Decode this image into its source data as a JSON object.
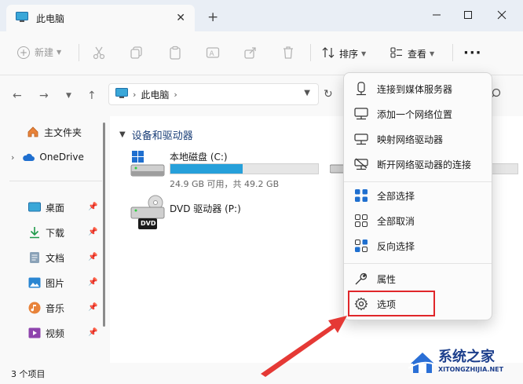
{
  "window": {
    "tab_title": "此电脑",
    "new_tab_glyph": "+",
    "close_tab_glyph": "✕"
  },
  "toolbar": {
    "new_label": "新建",
    "sort_label": "排序",
    "view_label": "查看",
    "more_glyph": "···"
  },
  "address": {
    "path": "此电脑"
  },
  "sidebar": {
    "items": [
      {
        "label": "主文件夹",
        "icon": "home-icon"
      },
      {
        "label": "OneDrive",
        "icon": "cloud-icon"
      },
      {
        "label": "桌面",
        "icon": "desktop-icon"
      },
      {
        "label": "下载",
        "icon": "download-icon"
      },
      {
        "label": "文档",
        "icon": "document-icon"
      },
      {
        "label": "图片",
        "icon": "picture-icon"
      },
      {
        "label": "音乐",
        "icon": "music-icon"
      },
      {
        "label": "视频",
        "icon": "video-icon"
      }
    ]
  },
  "main": {
    "group_title": "设备和驱动器",
    "drives": [
      {
        "name": "本地磁盘 (C:)",
        "free_text": "24.9 GB 可用，共 49.2 GB",
        "used_fraction": 0.49
      },
      {
        "name": "DVD 驱动器 (P:)",
        "badge": "DVD"
      }
    ]
  },
  "status": {
    "text": "3 个项目"
  },
  "context_menu": {
    "items": [
      {
        "label": "连接到媒体服务器",
        "icon": "media-server-icon"
      },
      {
        "label": "添加一个网络位置",
        "icon": "network-location-icon"
      },
      {
        "label": "映射网络驱动器",
        "icon": "map-drive-icon"
      },
      {
        "label": "断开网络驱动器的连接",
        "icon": "disconnect-drive-icon"
      },
      {
        "label": "全部选择",
        "icon": "select-all-icon"
      },
      {
        "label": "全部取消",
        "icon": "select-none-icon"
      },
      {
        "label": "反向选择",
        "icon": "invert-selection-icon"
      },
      {
        "label": "属性",
        "icon": "properties-icon"
      },
      {
        "label": "选项",
        "icon": "gear-icon"
      }
    ]
  },
  "watermark": {
    "title": "系统之家",
    "url": "XITONGZHIJIA.NET"
  },
  "colors": {
    "accent": "#26a0da",
    "highlight": "#e0262a",
    "arrow": "#e53935"
  }
}
